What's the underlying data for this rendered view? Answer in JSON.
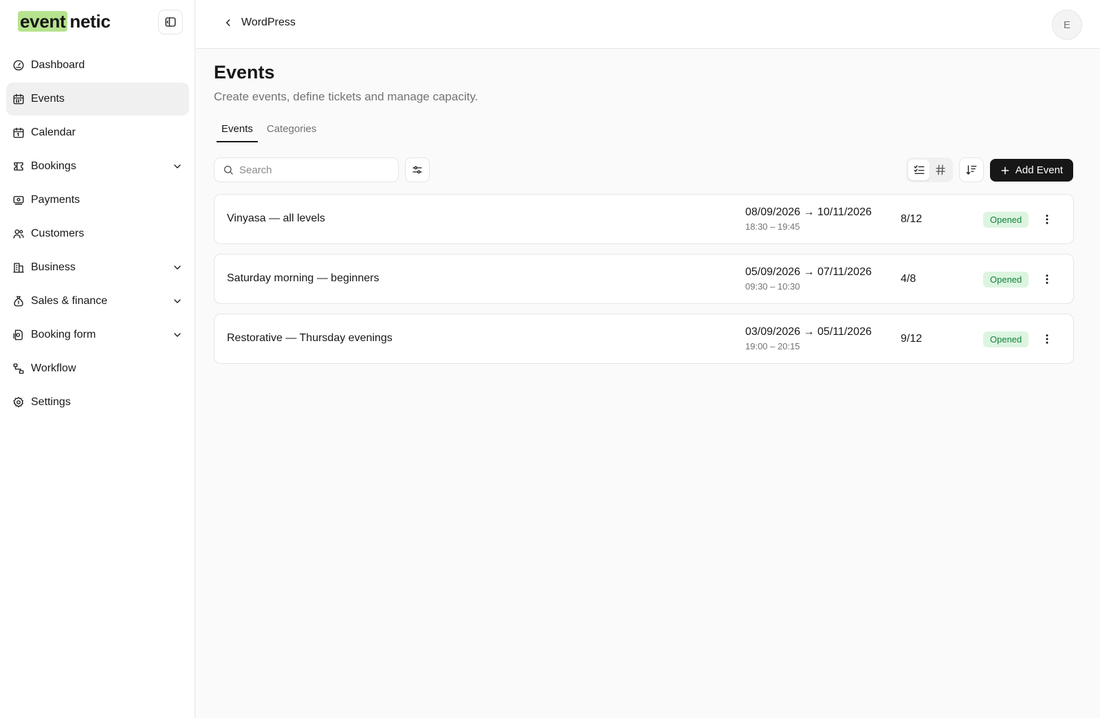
{
  "brand": {
    "part1": "event",
    "part2": "netic",
    "highlight_color": "#b6e38e"
  },
  "sidebar": {
    "items": [
      {
        "label": "Dashboard",
        "icon": "gauge-icon",
        "active": false,
        "expandable": false
      },
      {
        "label": "Events",
        "icon": "calendar-grid-icon",
        "active": true,
        "expandable": false
      },
      {
        "label": "Calendar",
        "icon": "calendar-icon",
        "active": false,
        "expandable": false
      },
      {
        "label": "Bookings",
        "icon": "ticket-icon",
        "active": false,
        "expandable": true
      },
      {
        "label": "Payments",
        "icon": "banknote-icon",
        "active": false,
        "expandable": false
      },
      {
        "label": "Customers",
        "icon": "users-icon",
        "active": false,
        "expandable": false
      },
      {
        "label": "Business",
        "icon": "building-icon",
        "active": false,
        "expandable": true
      },
      {
        "label": "Sales & finance",
        "icon": "money-bag-icon",
        "active": false,
        "expandable": true
      },
      {
        "label": "Booking form",
        "icon": "form-icon",
        "active": false,
        "expandable": true
      },
      {
        "label": "Workflow",
        "icon": "workflow-icon",
        "active": false,
        "expandable": false
      },
      {
        "label": "Settings",
        "icon": "gear-icon",
        "active": false,
        "expandable": false
      }
    ]
  },
  "topbar": {
    "back_label": "WordPress",
    "avatar_initial": "E"
  },
  "page": {
    "title": "Events",
    "subtitle": "Create events, define tickets and manage capacity.",
    "tabs": [
      {
        "label": "Events",
        "active": true
      },
      {
        "label": "Categories",
        "active": false
      }
    ]
  },
  "toolbar": {
    "search_placeholder": "Search",
    "add_label": "Add Event"
  },
  "events": [
    {
      "name": "Vinyasa — all levels",
      "dates": "08/09/2026 → 10/11/2026",
      "times": "18:30 – 19:45",
      "capacity": "8/12",
      "status": "Opened"
    },
    {
      "name": "Saturday morning — beginners",
      "dates": "05/09/2026 → 07/11/2026",
      "times": "09:30 – 10:30",
      "capacity": "4/8",
      "status": "Opened"
    },
    {
      "name": "Restorative — Thursday evenings",
      "dates": "03/09/2026 → 05/11/2026",
      "times": "19:00 – 20:15",
      "capacity": "9/12",
      "status": "Opened"
    }
  ],
  "colors": {
    "accent_dark": "#171717",
    "status_bg": "#dcf5e0",
    "status_text": "#15803d"
  }
}
